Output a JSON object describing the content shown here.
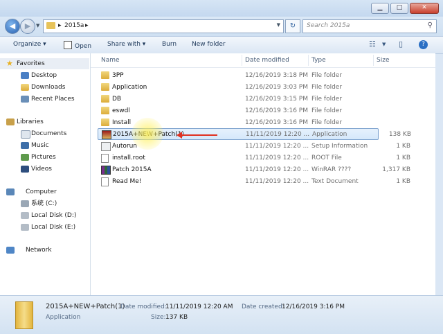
{
  "window": {
    "min_label": "▁",
    "max_label": "□",
    "close_label": "✕"
  },
  "address": {
    "crumb_sep": "▸",
    "crumb": "2015a",
    "crumb_sep2": "▸"
  },
  "search": {
    "placeholder": "Search 2015a"
  },
  "toolbar": {
    "organize": "Organize ▾",
    "open": "Open",
    "share_with": "Share with ▾",
    "burn": "Burn",
    "new_folder": "New folder"
  },
  "nav": {
    "favorites": "Favorites",
    "desktop": "Desktop",
    "downloads": "Downloads",
    "recent_places": "Recent Places",
    "libraries": "Libraries",
    "documents": "Documents",
    "music": "Music",
    "pictures": "Pictures",
    "videos": "Videos",
    "computer": "Computer",
    "drive_c": "系统 (C:)",
    "drive_d": "Local Disk (D:)",
    "drive_e": "Local Disk (E:)",
    "network": "Network"
  },
  "columns": {
    "name": "Name",
    "date": "Date modified",
    "type": "Type",
    "size": "Size"
  },
  "files": [
    {
      "name": "3PP",
      "date": "12/16/2019 3:18 PM",
      "type": "File folder",
      "size": ""
    },
    {
      "name": "Application",
      "date": "12/16/2019 3:03 PM",
      "type": "File folder",
      "size": ""
    },
    {
      "name": "DB",
      "date": "12/16/2019 3:15 PM",
      "type": "File folder",
      "size": ""
    },
    {
      "name": "eswdl",
      "date": "12/16/2019 3:16 PM",
      "type": "File folder",
      "size": ""
    },
    {
      "name": "Install",
      "date": "12/16/2019 3:16 PM",
      "type": "File folder",
      "size": ""
    },
    {
      "name": "2015A+NEW+Patch(1)",
      "date": "11/11/2019 12:20 ...",
      "type": "Application",
      "size": "138 KB"
    },
    {
      "name": "Autorun",
      "date": "11/11/2019 12:20 ...",
      "type": "Setup Information",
      "size": "1 KB"
    },
    {
      "name": "install.root",
      "date": "11/11/2019 12:20 ...",
      "type": "ROOT File",
      "size": "1 KB"
    },
    {
      "name": "Patch 2015A",
      "date": "11/11/2019 12:20 ...",
      "type": "WinRAR ????",
      "size": "1,317 KB"
    },
    {
      "name": "Read Me!",
      "date": "11/11/2019 12:20 ...",
      "type": "Text Document",
      "size": "1 KB"
    }
  ],
  "details": {
    "name": "2015A+NEW+Patch(1)",
    "type": "Application",
    "date_modified_label": "Date modified:",
    "date_modified": "11/11/2019 12:20 AM",
    "date_created_label": "Date created:",
    "date_created": "12/16/2019 3:16 PM",
    "size_label": "Size:",
    "size": "137 KB"
  },
  "colors": {
    "selection": "#d5e8fb",
    "arrow": "#e03020"
  }
}
